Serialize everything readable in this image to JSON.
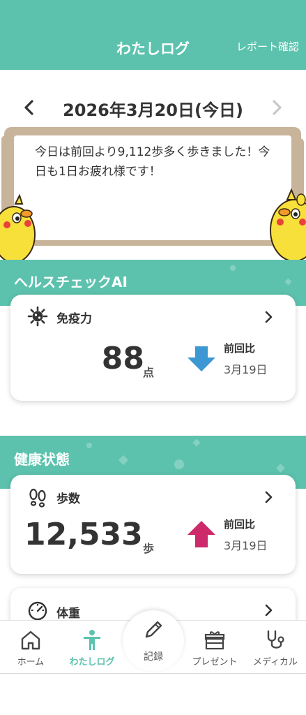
{
  "header": {
    "title": "わたしログ",
    "report_link": "レポート確認"
  },
  "date_nav": {
    "date": "2026年3月20日(今日)",
    "prev_icon": "chevron-left-icon",
    "next_icon": "chevron-right-icon"
  },
  "message": {
    "text": "今日は前回より9,112歩多く歩きました！今日も1日お疲れ様です！"
  },
  "health_check": {
    "section_title": "ヘルスチェックAI",
    "card": {
      "title": "免疫力",
      "icon": "virus-icon",
      "value": "88",
      "unit": "点",
      "compare_label": "前回比",
      "compare_date": "3月19日",
      "trend": "down",
      "trend_color": "#3d97d3"
    }
  },
  "health_status": {
    "section_title": "健康状態",
    "steps_card": {
      "title": "歩数",
      "icon": "footprints-icon",
      "value": "12,533",
      "unit": "歩",
      "compare_label": "前回比",
      "compare_date": "3月19日",
      "trend": "up",
      "trend_color": "#cc2a6b"
    },
    "weight_card": {
      "title": "体重",
      "icon": "scale-icon"
    }
  },
  "tabbar": {
    "items": [
      {
        "label": "ホーム",
        "icon": "home-icon"
      },
      {
        "label": "わたしログ",
        "icon": "person-icon",
        "active": true
      },
      {
        "label": "記録",
        "icon": "pencil-icon"
      },
      {
        "label": "プレゼント",
        "icon": "gift-icon"
      },
      {
        "label": "メディカル",
        "icon": "stethoscope-icon"
      }
    ]
  },
  "colors": {
    "accent": "#5cc2ad",
    "board": "#c7b49a",
    "chick": "#f7e03a"
  }
}
